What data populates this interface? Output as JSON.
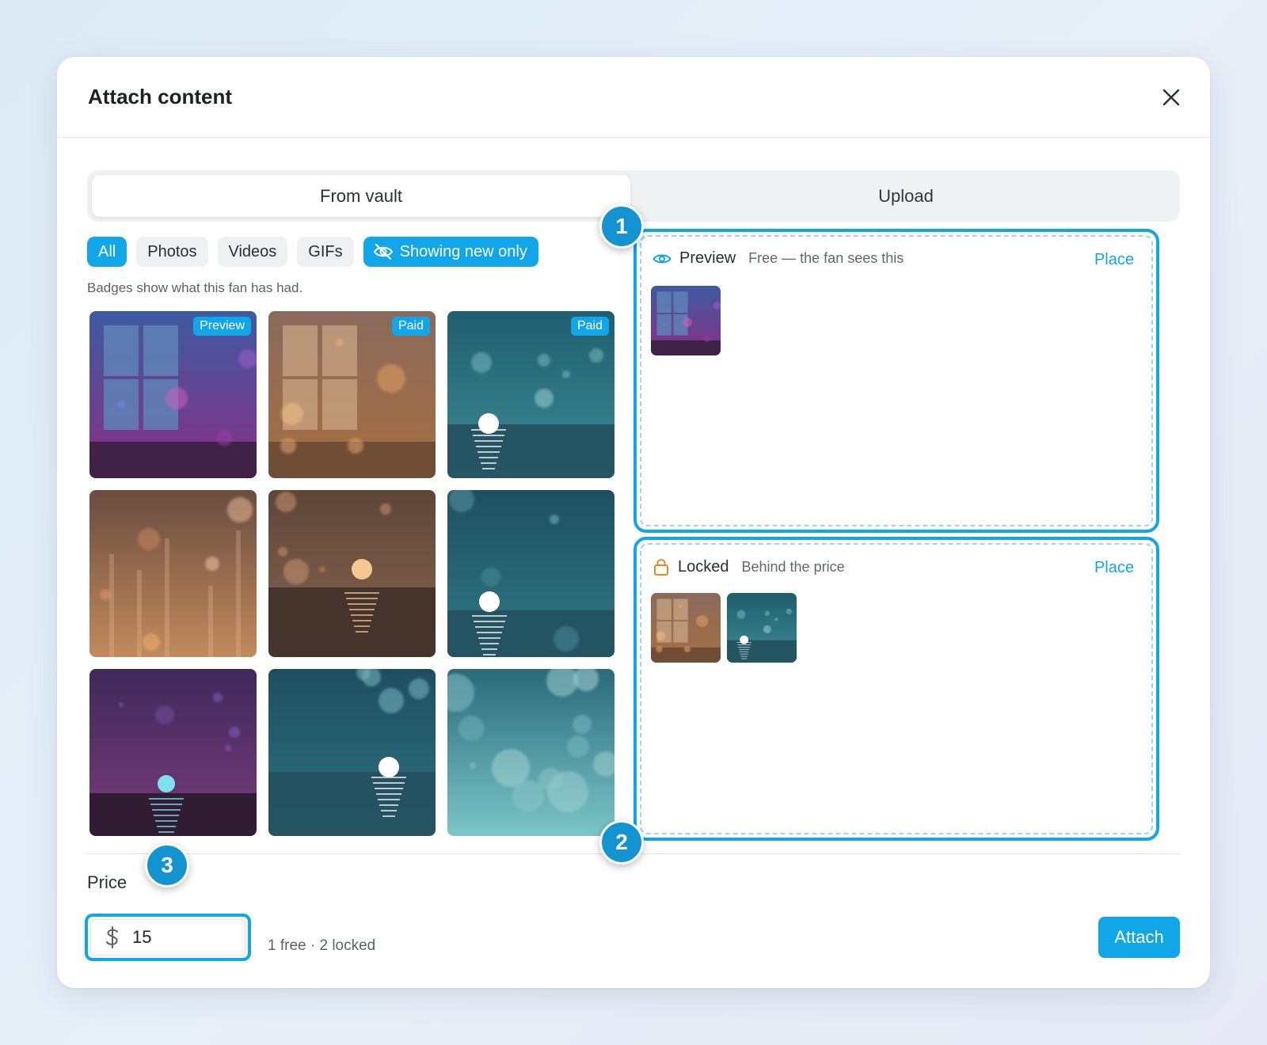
{
  "dialog": {
    "title": "Attach content",
    "close_icon": "close-icon"
  },
  "tabs": [
    {
      "label": "From vault",
      "active": true
    },
    {
      "label": "Upload",
      "active": false
    }
  ],
  "filters": {
    "chips": [
      {
        "label": "All",
        "selected": true
      },
      {
        "label": "Photos",
        "selected": false
      },
      {
        "label": "Videos",
        "selected": false
      },
      {
        "label": "GIFs",
        "selected": false
      }
    ],
    "toggle_label": "Showing new only",
    "toggle_icon": "eye-off-icon"
  },
  "hint": "Badges show what this fan has had.",
  "vault": [
    {
      "scene": "window-purple",
      "badge": "Preview"
    },
    {
      "scene": "window-amber",
      "badge": "Paid"
    },
    {
      "scene": "sea-teal",
      "badge": "Paid"
    },
    {
      "scene": "streaks-amber",
      "badge": ""
    },
    {
      "scene": "sunset-amber",
      "badge": ""
    },
    {
      "scene": "sea-teal-dark",
      "badge": ""
    },
    {
      "scene": "moon-purple",
      "badge": ""
    },
    {
      "scene": "sea-teal-moon",
      "badge": ""
    },
    {
      "scene": "bokeh-teal",
      "badge": ""
    }
  ],
  "zones": {
    "preview": {
      "title": "Preview",
      "subtitle": "Free — the fan sees this",
      "action": "Place",
      "icon": "eye-icon",
      "items": [
        "window-purple"
      ]
    },
    "locked": {
      "title": "Locked",
      "subtitle": "Behind the price",
      "action": "Place",
      "icon": "lock-icon",
      "items": [
        "window-amber",
        "sea-teal"
      ]
    }
  },
  "markers": [
    "1",
    "2",
    "3"
  ],
  "footer": {
    "price_label": "Price",
    "currency_symbol": "$",
    "price_value": "15",
    "summary": "1 free · 2 locked",
    "attach_label": "Attach"
  },
  "colors": {
    "accent": "#11a6e8",
    "marker": "#1493d1"
  }
}
